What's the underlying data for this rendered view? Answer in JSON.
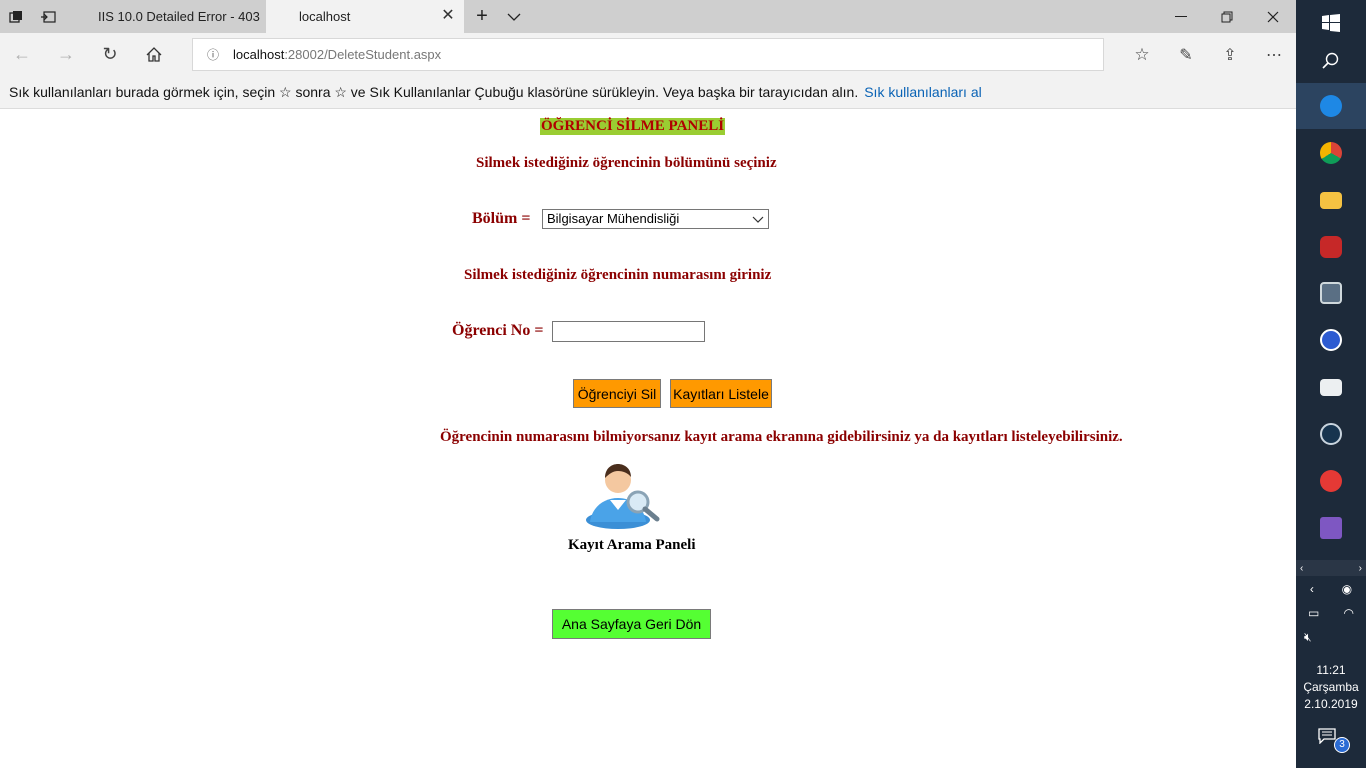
{
  "browser": {
    "tabs": [
      {
        "title": "IIS 10.0 Detailed Error - 403",
        "active": false
      },
      {
        "title": "localhost",
        "active": true
      }
    ],
    "address": {
      "host": "localhost",
      "path": ":28002/DeleteStudent.aspx"
    },
    "favorites_bar": {
      "message": "Sık kullanılanları burada görmek için, seçin  ☆  sonra ☆ ve Sık Kullanılanlar Çubuğu klasörüne sürükleyin. Veya başka bir tarayıcıdan alın.",
      "link": "Sık kullanılanları al"
    }
  },
  "page": {
    "title": "ÖĞRENCİ SİLME PANELİ",
    "select_department_prompt": "Silmek istediğiniz öğrencinin bölümünü seçiniz",
    "department_label": "Bölüm =",
    "department_selected": "Bilgisayar Mühendisliği",
    "number_prompt": "Silmek istediğiniz öğrencinin numarasını giriniz",
    "student_no_label": "Öğrenci No =",
    "student_no_value": "",
    "delete_button": "Öğrenciyi Sil",
    "list_button": "Kayıtları Listele",
    "hint": "Öğrencinin numarasını bilmiyorsanız kayıt arama ekranına gidebilirsiniz ya da kayıtları listeleyebilirsiniz.",
    "search_caption": "Kayıt Arama Paneli",
    "home_button": "Ana Sayfaya Geri Dön"
  },
  "taskbar": {
    "time": "11:21",
    "day": "Çarşamba",
    "date": "2.10.2019",
    "notification_count": "3"
  },
  "colors": {
    "title_bg": "#9acd32",
    "heading_text": "#8b0000",
    "action_button": "#ff9900",
    "home_button": "#55ff33",
    "link": "#0a63b5",
    "taskbar": "#1d2a3a"
  }
}
